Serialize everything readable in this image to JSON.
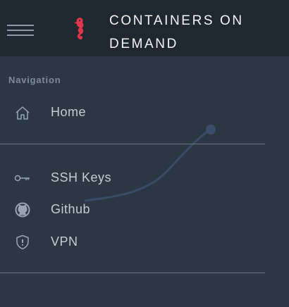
{
  "header": {
    "brand_line1": "CONTAINERS ON",
    "brand_line2": "DEMAND",
    "logo_icon": "seahorse-icon",
    "menu_icon": "hamburger-menu-icon"
  },
  "navigation": {
    "title": "Navigation",
    "items": [
      {
        "label": "Home",
        "icon": "home-icon"
      },
      {
        "label": "SSH Keys",
        "icon": "key-icon"
      },
      {
        "label": "Github",
        "icon": "github-icon"
      },
      {
        "label": "VPN",
        "icon": "shield-icon"
      }
    ]
  },
  "colors": {
    "background": "#2d3743",
    "header_background": "#1f2731",
    "accent_red": "#e0354a",
    "text": "#c4ccd5"
  }
}
